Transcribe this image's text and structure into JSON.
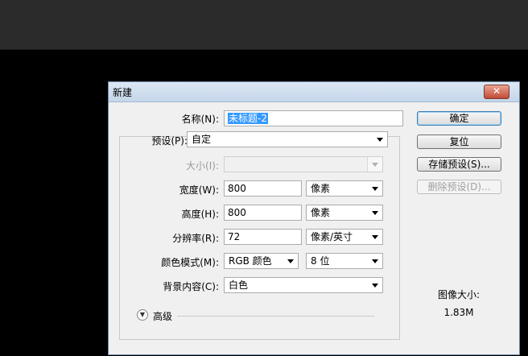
{
  "dialog": {
    "title": "新建",
    "close_label": "✕"
  },
  "form": {
    "name": {
      "label": "名称(N):",
      "value": "未标题-2"
    },
    "preset": {
      "label": "预设(P):",
      "value": "自定"
    },
    "size": {
      "label": "大小(I):",
      "value": ""
    },
    "width": {
      "label": "宽度(W):",
      "value": "800",
      "unit": "像素"
    },
    "height": {
      "label": "高度(H):",
      "value": "800",
      "unit": "像素"
    },
    "resolution": {
      "label": "分辨率(R):",
      "value": "72",
      "unit": "像素/英寸"
    },
    "color_mode": {
      "label": "颜色模式(M):",
      "value": "RGB 颜色",
      "depth": "8 位"
    },
    "background": {
      "label": "背景内容(C):",
      "value": "白色"
    },
    "advanced": {
      "label": "高级",
      "icon": "chevron-double-down-icon"
    }
  },
  "buttons": {
    "ok": "确定",
    "reset": "复位",
    "save_preset": "存储预设(S)...",
    "delete_preset": "删除预设(D)..."
  },
  "image_size": {
    "label": "图像大小:",
    "value": "1.83M"
  },
  "colors": {
    "titlebar": "#c5d6ea",
    "selection": "#3399ff",
    "close_button": "#c24b34",
    "app_background": "#000000",
    "toolbar": "#2b2b2b"
  }
}
